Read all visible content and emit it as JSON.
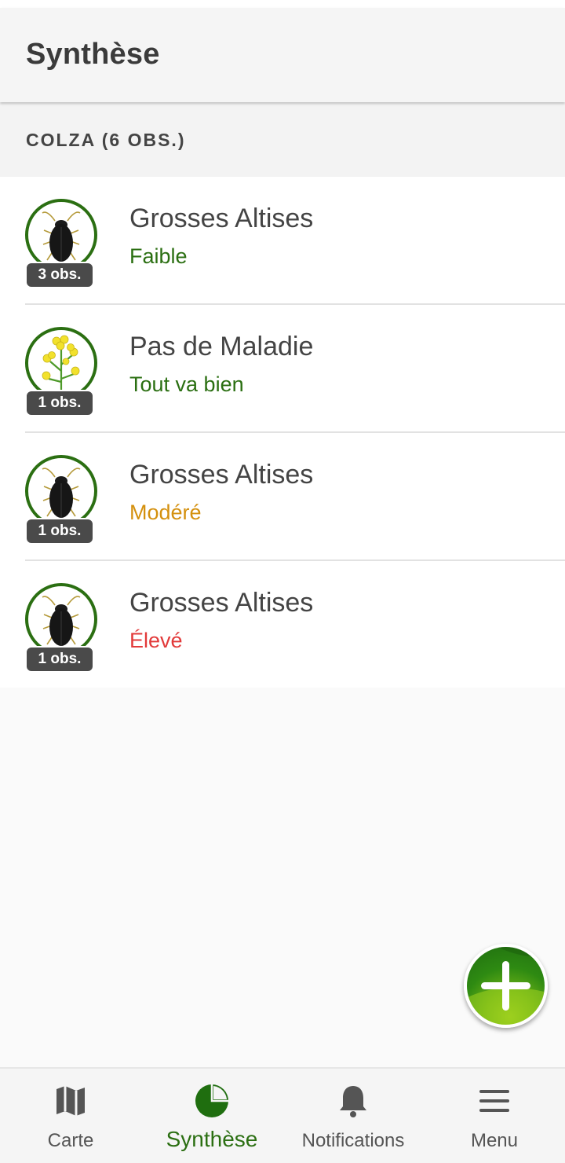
{
  "header": {
    "title": "Synthèse"
  },
  "section": {
    "label": "COLZA (6 OBS.)"
  },
  "items": [
    {
      "icon": "beetle-icon",
      "badge": "3 obs.",
      "title": "Grosses Altises",
      "status": "Faible",
      "status_color": "#2b6f12"
    },
    {
      "icon": "rapeseed-flower-icon",
      "badge": "1 obs.",
      "title": "Pas de Maladie",
      "status": "Tout va bien",
      "status_color": "#2b6f12"
    },
    {
      "icon": "beetle-icon",
      "badge": "1 obs.",
      "title": "Grosses Altises",
      "status": "Modéré",
      "status_color": "#d4900e"
    },
    {
      "icon": "beetle-icon",
      "badge": "1 obs.",
      "title": "Grosses Altises",
      "status": "Élevé",
      "status_color": "#e23a3a"
    }
  ],
  "fab": {
    "icon": "plus-icon"
  },
  "nav": {
    "items": [
      {
        "label": "Carte",
        "icon": "map-icon",
        "active": false
      },
      {
        "label": "Synthèse",
        "icon": "pie-chart-icon",
        "active": true
      },
      {
        "label": "Notifications",
        "icon": "bell-icon",
        "active": false
      },
      {
        "label": "Menu",
        "icon": "hamburger-menu-icon",
        "active": false
      }
    ]
  },
  "colors": {
    "accent": "#2b6f12",
    "moderate": "#d4900e",
    "high": "#e23a3a"
  }
}
